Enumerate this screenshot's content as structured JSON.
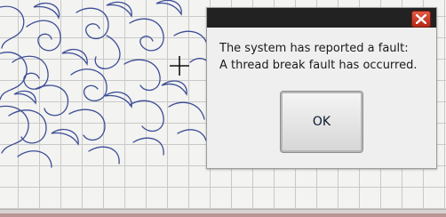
{
  "dialog": {
    "message_line1": "The system has reported a fault:",
    "message_line2": "A thread break fault has occurred.",
    "ok_label": "OK",
    "close_icon": "close-x-icon"
  },
  "colors": {
    "pattern_stroke": "#3c4d96",
    "close_button": "#cc3a26",
    "titlebar": "#222222"
  }
}
